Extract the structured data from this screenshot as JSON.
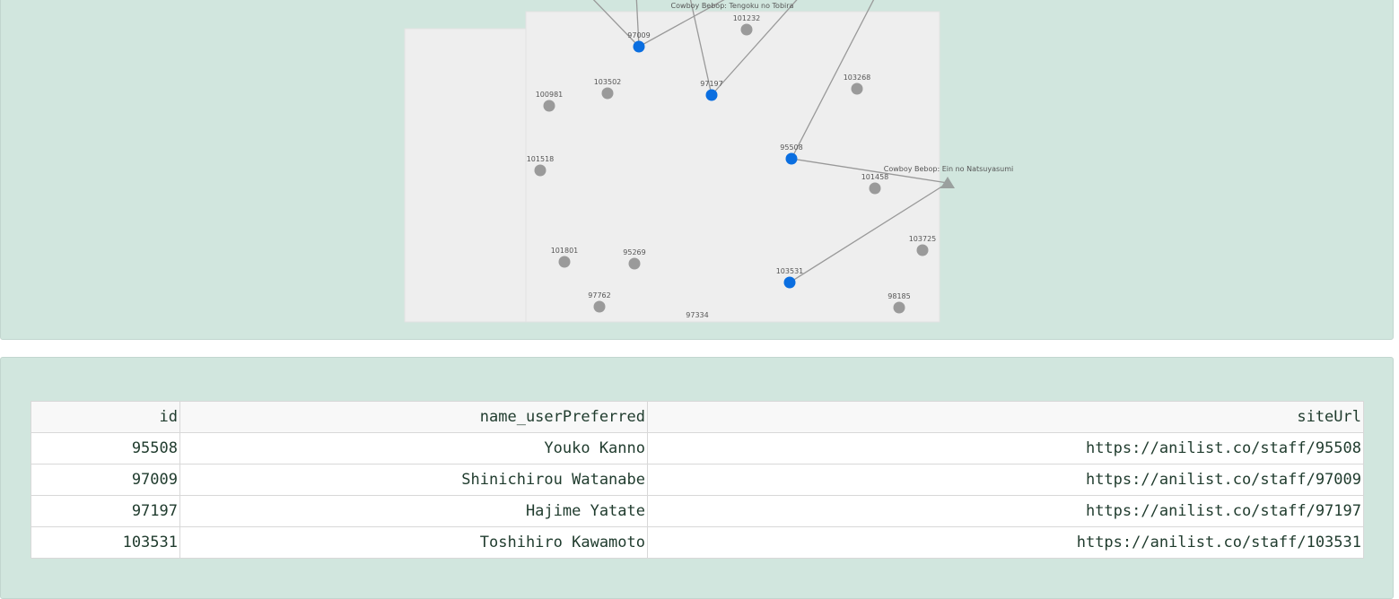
{
  "graph": {
    "nodes": [
      {
        "id": "97009",
        "label": "97009",
        "type": "staff-selected"
      },
      {
        "id": "97197",
        "label": "97197",
        "type": "staff-selected"
      },
      {
        "id": "95508",
        "label": "95508",
        "type": "staff-selected"
      },
      {
        "id": "103531",
        "label": "103531",
        "type": "staff-selected"
      },
      {
        "id": "101232",
        "label": "101232",
        "type": "staff"
      },
      {
        "id": "103502",
        "label": "103502",
        "type": "staff"
      },
      {
        "id": "100981",
        "label": "100981",
        "type": "staff"
      },
      {
        "id": "103268",
        "label": "103268",
        "type": "staff"
      },
      {
        "id": "101518",
        "label": "101518",
        "type": "staff"
      },
      {
        "id": "101458",
        "label": "101458",
        "type": "staff"
      },
      {
        "id": "101801",
        "label": "101801",
        "type": "staff"
      },
      {
        "id": "95269",
        "label": "95269",
        "type": "staff"
      },
      {
        "id": "103725",
        "label": "103725",
        "type": "staff"
      },
      {
        "id": "97762",
        "label": "97762",
        "type": "staff"
      },
      {
        "id": "98185",
        "label": "98185",
        "type": "staff"
      },
      {
        "id": "97334",
        "label": "97334",
        "type": "staff"
      },
      {
        "id": "ein",
        "label": "Cowboy Bebop: Ein no Natsuyasumi",
        "type": "media"
      },
      {
        "id": "tengoku",
        "label": "Cowboy Bebop: Tengoku no Tobira",
        "type": "media"
      }
    ],
    "colors": {
      "selected": "#0a6ee0",
      "staff": "#9a9a9a",
      "media": "#9aa09e",
      "edge": "#999999",
      "canvas": "#eeeeee"
    }
  },
  "table": {
    "columns": [
      "id",
      "name_userPreferred",
      "siteUrl"
    ],
    "rows": [
      [
        "95508",
        "Youko Kanno",
        "https://anilist.co/staff/95508"
      ],
      [
        "97009",
        "Shinichirou Watanabe",
        "https://anilist.co/staff/97009"
      ],
      [
        "97197",
        "Hajime Yatate",
        "https://anilist.co/staff/97197"
      ],
      [
        "103531",
        "Toshihiro Kawamoto",
        "https://anilist.co/staff/103531"
      ]
    ]
  }
}
